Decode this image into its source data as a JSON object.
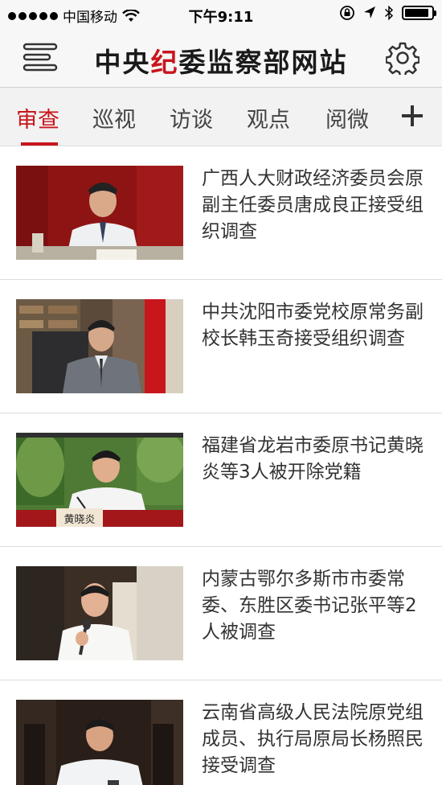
{
  "status_bar": {
    "carrier": "中国移动",
    "time": "下午9:11",
    "battery_level": 0.9
  },
  "header": {
    "title_part1": "中央",
    "title_highlight": "纪",
    "title_part2": "委监察部网站",
    "brand_red": "#c8161d",
    "menu_icon": "menu-icon",
    "settings_icon": "gear-icon"
  },
  "tabs": [
    {
      "label": "审查",
      "active": true
    },
    {
      "label": "巡视",
      "active": false
    },
    {
      "label": "访谈",
      "active": false
    },
    {
      "label": "观点",
      "active": false
    },
    {
      "label": "阅微",
      "active": false
    }
  ],
  "tab_add_icon": "plus-icon",
  "news": [
    {
      "title": "广西人大财政经济委员会原副主任委员唐成良正接受组织调查"
    },
    {
      "title": "中共沈阳市委党校原常务副校长韩玉奇接受组织调查"
    },
    {
      "title": "福建省龙岩市委原书记黄晓炎等3人被开除党籍",
      "thumb_caption": "黄晓炎"
    },
    {
      "title": "内蒙古鄂尔多斯市市委常委、东胜区委书记张平等2人被调查"
    },
    {
      "title": "云南省高级人民法院原党组成员、执行局原局长杨照民接受调查"
    }
  ]
}
